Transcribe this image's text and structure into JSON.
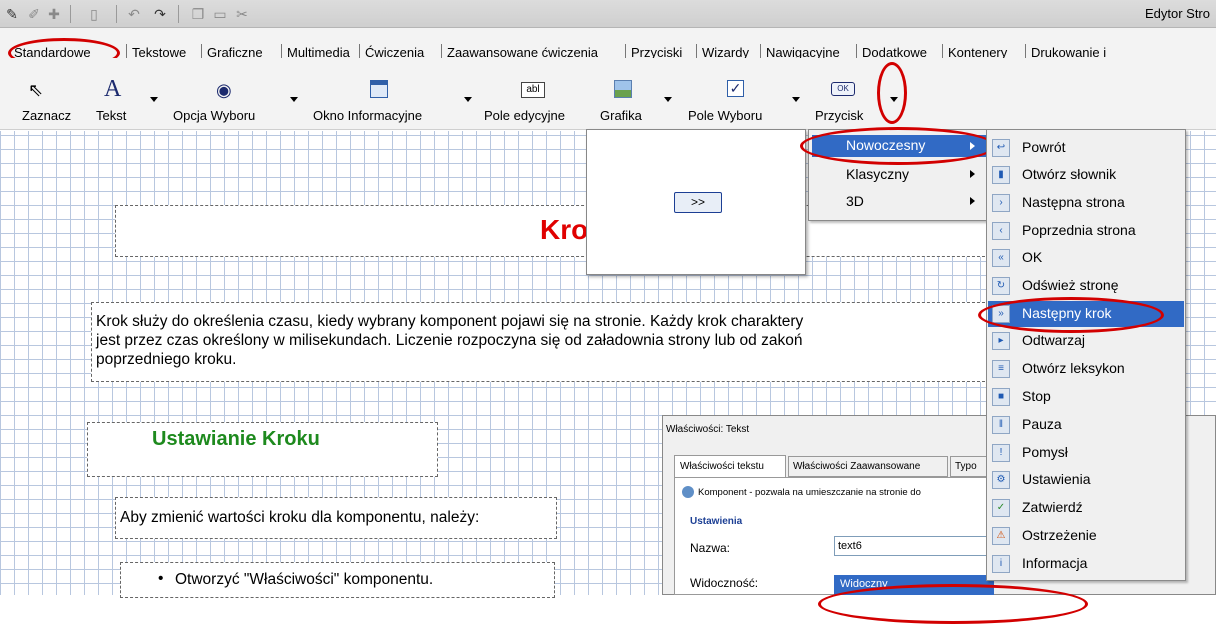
{
  "window": {
    "title": "Edytor Stro"
  },
  "titlebar_icons": [
    "edit-page-icon",
    "pencil-icon",
    "plus-icon",
    "page-icon",
    "undo-icon",
    "redo-icon",
    "copy-icon",
    "paste-icon",
    "cut-icon"
  ],
  "tabs": [
    {
      "label": "Standardowe"
    },
    {
      "label": "Tekstowe"
    },
    {
      "label": "Graficzne"
    },
    {
      "label": "Multimedia"
    },
    {
      "label": "Ćwiczenia"
    },
    {
      "label": "Zaawansowane ćwiczenia"
    },
    {
      "label": "Przyciski"
    },
    {
      "label": "Wizardy"
    },
    {
      "label": "Nawigacyjne"
    },
    {
      "label": "Dodatkowe"
    },
    {
      "label": "Kontenery"
    },
    {
      "label": "Drukowanie i"
    }
  ],
  "toolbar": {
    "items": [
      {
        "label": "Zaznacz",
        "icon": "cursor-icon"
      },
      {
        "label": "Tekst",
        "icon": "text-icon"
      },
      {
        "label": "Opcja Wyboru",
        "icon": "radio-icon"
      },
      {
        "label": "Okno Informacyjne",
        "icon": "window-icon"
      },
      {
        "label": "Pole edycyjne",
        "icon": "textbox-icon",
        "icon_text": "abl"
      },
      {
        "label": "Grafika",
        "icon": "image-icon"
      },
      {
        "label": "Pole Wyboru",
        "icon": "checkbox-icon"
      },
      {
        "label": "Przycisk",
        "icon": "button-icon",
        "icon_text": "OK"
      }
    ]
  },
  "preview": {
    "button_label": ">>"
  },
  "menu": {
    "items": [
      {
        "label": "Nowoczesny"
      },
      {
        "label": "Klasyczny"
      },
      {
        "label": "3D"
      }
    ],
    "submenu": [
      {
        "label": "Powrót"
      },
      {
        "label": "Otwórz słownik"
      },
      {
        "label": "Następna strona"
      },
      {
        "label": "Poprzednia strona"
      },
      {
        "label": "OK"
      },
      {
        "label": "Odśwież stronę"
      },
      {
        "label": "Następny krok"
      },
      {
        "label": "Odtwarzaj"
      },
      {
        "label": "Otwórz leksykon"
      },
      {
        "label": "Stop"
      },
      {
        "label": "Pauza"
      },
      {
        "label": "Pomysł"
      },
      {
        "label": "Ustawienia"
      },
      {
        "label": "Zatwierdź"
      },
      {
        "label": "Ostrzeżenie"
      },
      {
        "label": "Informacja"
      }
    ]
  },
  "document": {
    "heading_partial": "Kro",
    "paragraph_line1": "Krok służy do określenia czasu, kiedy wybrany komponent pojawi się na stronie. Każdy krok charaktery",
    "paragraph_line2": "jest przez czas określony w milisekundach. Liczenie rozpoczyna się od załadownia strony lub od zakoń",
    "paragraph_line3": "poprzedniego kroku.",
    "subheading": "Ustawianie Kroku",
    "instruction": "Aby zmienić wartości kroku dla komponentu, należy:",
    "bullet": "Otworzyć \"Właściwości\" komponentu."
  },
  "properties_dialog": {
    "title": "Właściwości: Tekst",
    "tabs": [
      "Właściwości tekstu",
      "Właściwości Zaawansowane",
      "Typo"
    ],
    "info": "Komponent - pozwala na umieszczanie na stronie do",
    "group": "Ustawienia",
    "name_label": "Nazwa:",
    "name_value": "text6",
    "visibility_label": "Widoczność:",
    "visibility_value": "Widoczny"
  },
  "colors": {
    "highlight": "#316ac5",
    "annotation": "#d20000",
    "heading": "#e00000",
    "subheading": "#1e8a1e",
    "grid": "#b8c7df"
  }
}
